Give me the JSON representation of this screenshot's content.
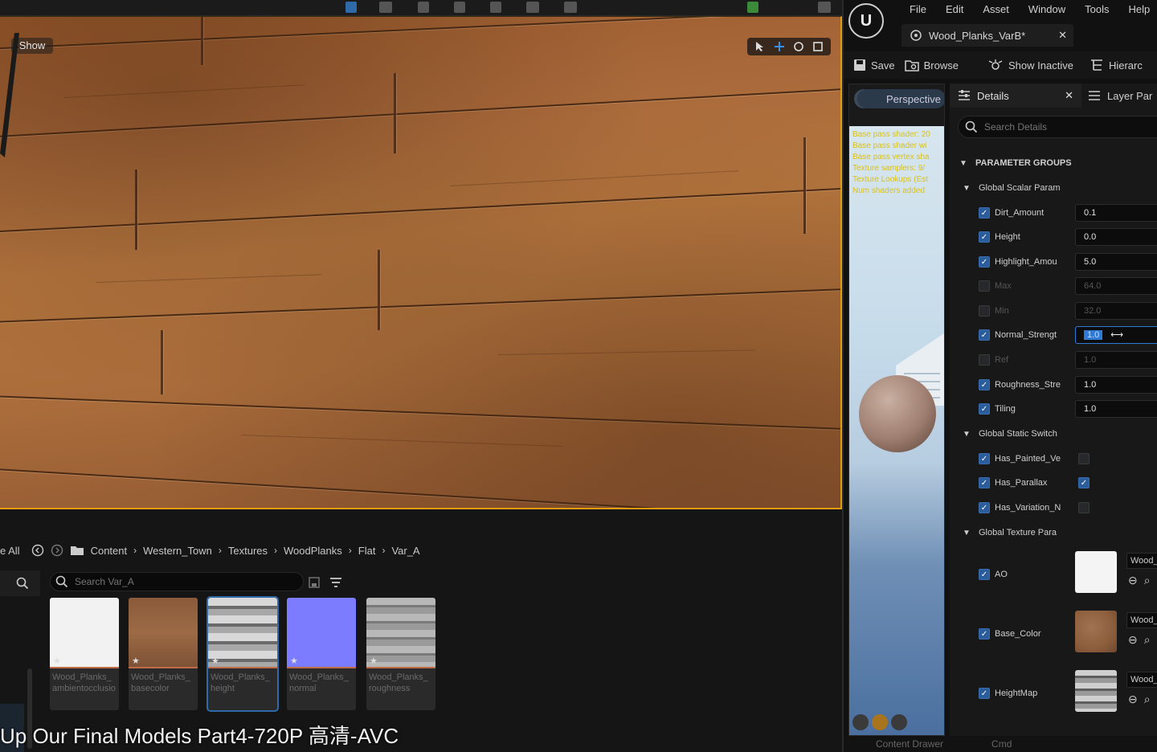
{
  "viewport": {
    "show_label": "Show"
  },
  "content_browser": {
    "path_prefix": "e All",
    "path": [
      "Content",
      "Western_Town",
      "Textures",
      "WoodPlanks",
      "Flat",
      "Var_A"
    ],
    "search_placeholder": "Search Var_A",
    "assets": [
      {
        "name": "Wood_Planks_ambientocclusion",
        "caption": "Wood_Planks_ ambientocclusio",
        "color": "#f2f2f2",
        "selected": false
      },
      {
        "name": "Wood_Planks_basecolor",
        "caption": "Wood_Planks_ basecolor",
        "color": "#8a5a3a",
        "selected": false
      },
      {
        "name": "Wood_Planks_height",
        "caption": "Wood_Planks_ height",
        "color": "#8a8a8a",
        "selected": true
      },
      {
        "name": "Wood_Planks_normal",
        "caption": "Wood_Planks_ normal",
        "color": "#7b7cff",
        "selected": false
      },
      {
        "name": "Wood_Planks_roughness",
        "caption": "Wood_Planks_ roughness",
        "color": "#9a9a9a",
        "selected": false
      }
    ],
    "bottom_tabs": {
      "content_drawer": "Content Drawer",
      "cmd": "Cmd"
    }
  },
  "subtitle": "Up Our Final Models Part4-720P 高清-AVC",
  "editor": {
    "logo": "U",
    "menu": [
      "File",
      "Edit",
      "Asset",
      "Window",
      "Tools",
      "Help"
    ],
    "doc_tab": "Wood_Planks_VarB*",
    "toolbar": {
      "save": "Save",
      "browse": "Browse",
      "show_inactive": "Show Inactive",
      "hierarchy": "Hierarc"
    },
    "viewport_tab": "Perspective",
    "stats": [
      "Base pass shader: 20",
      "Base pass shader wi",
      "Base pass vertex sha",
      "Texture samplers: 9/",
      "Texture Lookups (Est",
      "Num shaders added"
    ],
    "details_tab": "Details",
    "layer_tab": "Layer Par",
    "search_placeholder": "Search Details",
    "groups": {
      "parameter_groups": "PARAMETER GROUPS",
      "scalar": "Global Scalar Param",
      "switch": "Global Static Switch",
      "texture": "Global Texture Para"
    },
    "scalar_params": [
      {
        "name": "Dirt_Amount",
        "value": "0.1",
        "enabled": true
      },
      {
        "name": "Height",
        "value": "0.0",
        "enabled": true
      },
      {
        "name": "Highlight_Amou",
        "value": "5.0",
        "enabled": true
      },
      {
        "name": "Max",
        "value": "64.0",
        "enabled": false
      },
      {
        "name": "Min",
        "value": "32.0",
        "enabled": false
      },
      {
        "name": "Normal_Strengt",
        "value": "1.0",
        "enabled": true,
        "editing": true
      },
      {
        "name": "Ref",
        "value": "1.0",
        "enabled": false
      },
      {
        "name": "Roughness_Stre",
        "value": "1.0",
        "enabled": true
      },
      {
        "name": "Tiling",
        "value": "1.0",
        "enabled": true
      }
    ],
    "switch_params": [
      {
        "name": "Has_Painted_Ve",
        "enabled": true,
        "value": false
      },
      {
        "name": "Has_Parallax",
        "enabled": true,
        "value": true
      },
      {
        "name": "Has_Variation_N",
        "enabled": true,
        "value": false
      }
    ],
    "texture_params": [
      {
        "name": "AO",
        "asset": "Wood_",
        "color": "#f4f4f4"
      },
      {
        "name": "Base_Color",
        "asset": "Wood_",
        "color": "#8c5e3c"
      },
      {
        "name": "HeightMap",
        "asset": "Wood_",
        "color": "#8f8f8f"
      }
    ]
  }
}
